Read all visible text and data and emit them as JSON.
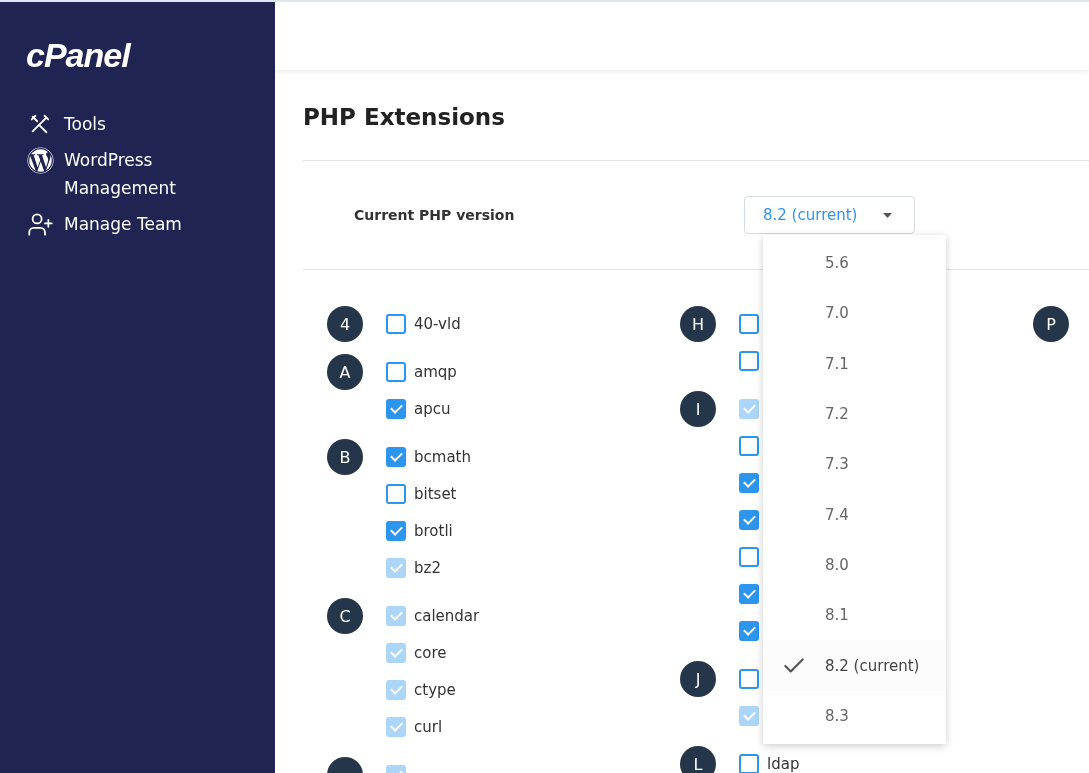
{
  "sidebar": {
    "logo": "cPanel",
    "items": [
      {
        "kind": "tools",
        "label": "Tools"
      },
      {
        "kind": "wordpress",
        "label": "WordPress Management"
      },
      {
        "kind": "team",
        "label": "Manage Team"
      }
    ]
  },
  "page": {
    "title": "PHP Extensions"
  },
  "version": {
    "label": "Current PHP version",
    "value": "8.2 (current)",
    "expanded": true,
    "options": [
      {
        "label": "5.6",
        "selected": false
      },
      {
        "label": "7.0",
        "selected": false
      },
      {
        "label": "7.1",
        "selected": false
      },
      {
        "label": "7.2",
        "selected": false
      },
      {
        "label": "7.3",
        "selected": false
      },
      {
        "label": "7.4",
        "selected": false
      },
      {
        "label": "8.0",
        "selected": false
      },
      {
        "label": "8.1",
        "selected": false
      },
      {
        "label": "8.2 (current)",
        "selected": true
      },
      {
        "label": "8.3",
        "selected": false
      }
    ]
  },
  "columns": [
    {
      "groups": [
        {
          "letter": "4",
          "items": [
            {
              "label": "40-vld",
              "checked": false,
              "disabled": false
            }
          ]
        },
        {
          "letter": "A",
          "items": [
            {
              "label": "amqp",
              "checked": false,
              "disabled": false
            },
            {
              "label": "apcu",
              "checked": true,
              "disabled": false
            }
          ]
        },
        {
          "letter": "B",
          "items": [
            {
              "label": "bcmath",
              "checked": true,
              "disabled": false
            },
            {
              "label": "bitset",
              "checked": false,
              "disabled": false
            },
            {
              "label": "brotli",
              "checked": true,
              "disabled": false
            },
            {
              "label": "bz2",
              "checked": true,
              "disabled": true
            }
          ]
        },
        {
          "letter": "C",
          "items": [
            {
              "label": "calendar",
              "checked": true,
              "disabled": true
            },
            {
              "label": "core",
              "checked": true,
              "disabled": true
            },
            {
              "label": "ctype",
              "checked": true,
              "disabled": true
            },
            {
              "label": "curl",
              "checked": true,
              "disabled": true
            }
          ]
        },
        {
          "items": [
            {
              "checked": true,
              "disabled": true
            }
          ]
        }
      ]
    },
    {
      "groups": [
        {
          "letter": "H",
          "items": [
            {
              "checked": false,
              "disabled": false
            },
            {
              "checked": false,
              "disabled": false
            }
          ]
        },
        {
          "letter": "I",
          "items": [
            {
              "checked": true,
              "disabled": true
            },
            {
              "checked": false,
              "disabled": false
            },
            {
              "checked": true,
              "disabled": false
            },
            {
              "checked": true,
              "disabled": false
            },
            {
              "checked": false,
              "disabled": false
            },
            {
              "checked": true,
              "disabled": false
            },
            {
              "checked": true,
              "disabled": false
            }
          ]
        },
        {
          "letter": "J",
          "items": [
            {
              "checked": false,
              "disabled": false
            },
            {
              "checked": true,
              "disabled": true
            }
          ]
        },
        {
          "letter": "L",
          "items": [
            {
              "label": "ldap",
              "checked": false,
              "disabled": false
            }
          ]
        }
      ]
    },
    {
      "groups": [
        {
          "letter": "P"
        }
      ]
    }
  ]
}
